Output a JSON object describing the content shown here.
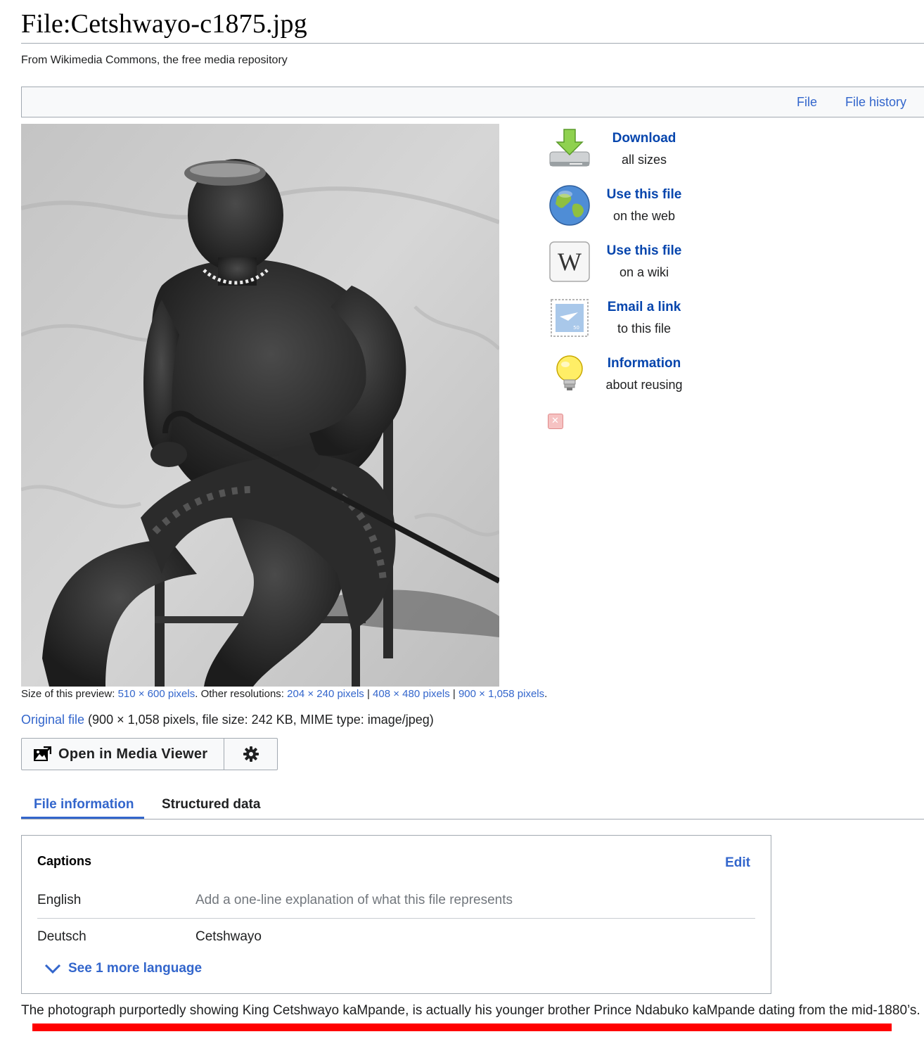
{
  "page": {
    "title": "File:Cetshwayo-c1875.jpg",
    "subtitle": "From Wikimedia Commons, the free media repository"
  },
  "filetoc": {
    "file_label": "File",
    "history_label": "File history"
  },
  "tools": [
    {
      "link": "Download",
      "sub": "all sizes",
      "icon": "download-icon"
    },
    {
      "link": "Use this file",
      "sub": "on the web",
      "icon": "globe-icon"
    },
    {
      "link": "Use this file",
      "sub": "on a wiki",
      "icon": "wikipedia-icon"
    },
    {
      "link": "Email a link",
      "sub": "to this file",
      "icon": "stamp-mail-icon"
    },
    {
      "link": "Information",
      "sub": "about reusing",
      "icon": "lightbulb-icon"
    }
  ],
  "preview": {
    "prefix": "Size of this preview: ",
    "preview_size": "510 × 600 pixels",
    "mid": ". Other resolutions: ",
    "res1": "204 × 240 pixels",
    "sep": " | ",
    "res2": "408 × 480 pixels",
    "res3": "900 × 1,058 pixels",
    "end": "."
  },
  "original": {
    "link": "Original file",
    "details": " (900 × 1,058 pixels, file size: 242 KB, MIME type: image/jpeg)"
  },
  "media_viewer": {
    "label": "Open in Media Viewer",
    "icon": "open-media-viewer-icon",
    "settings_icon": "gear-icon"
  },
  "tabs": [
    {
      "label": "File information",
      "active": true
    },
    {
      "label": "Structured data",
      "active": false
    }
  ],
  "captions": {
    "title": "Captions",
    "edit": "Edit",
    "rows": [
      {
        "lang": "English",
        "value": "Add a one-line explanation of what this file represents",
        "placeholder": true
      },
      {
        "lang": "Deutsch",
        "value": "Cetshwayo",
        "placeholder": false
      }
    ],
    "see_more": "See 1 more language"
  },
  "note": "The photograph purportedly showing King Cetshwayo kaMpande, is actually his younger brother Prince Ndabuko kaMpande dating from the mid-1880’s.",
  "colors": {
    "link": "#3366cc",
    "tool_link": "#0645ad",
    "border": "#a2a9b1",
    "highlight": "#ff0000"
  }
}
